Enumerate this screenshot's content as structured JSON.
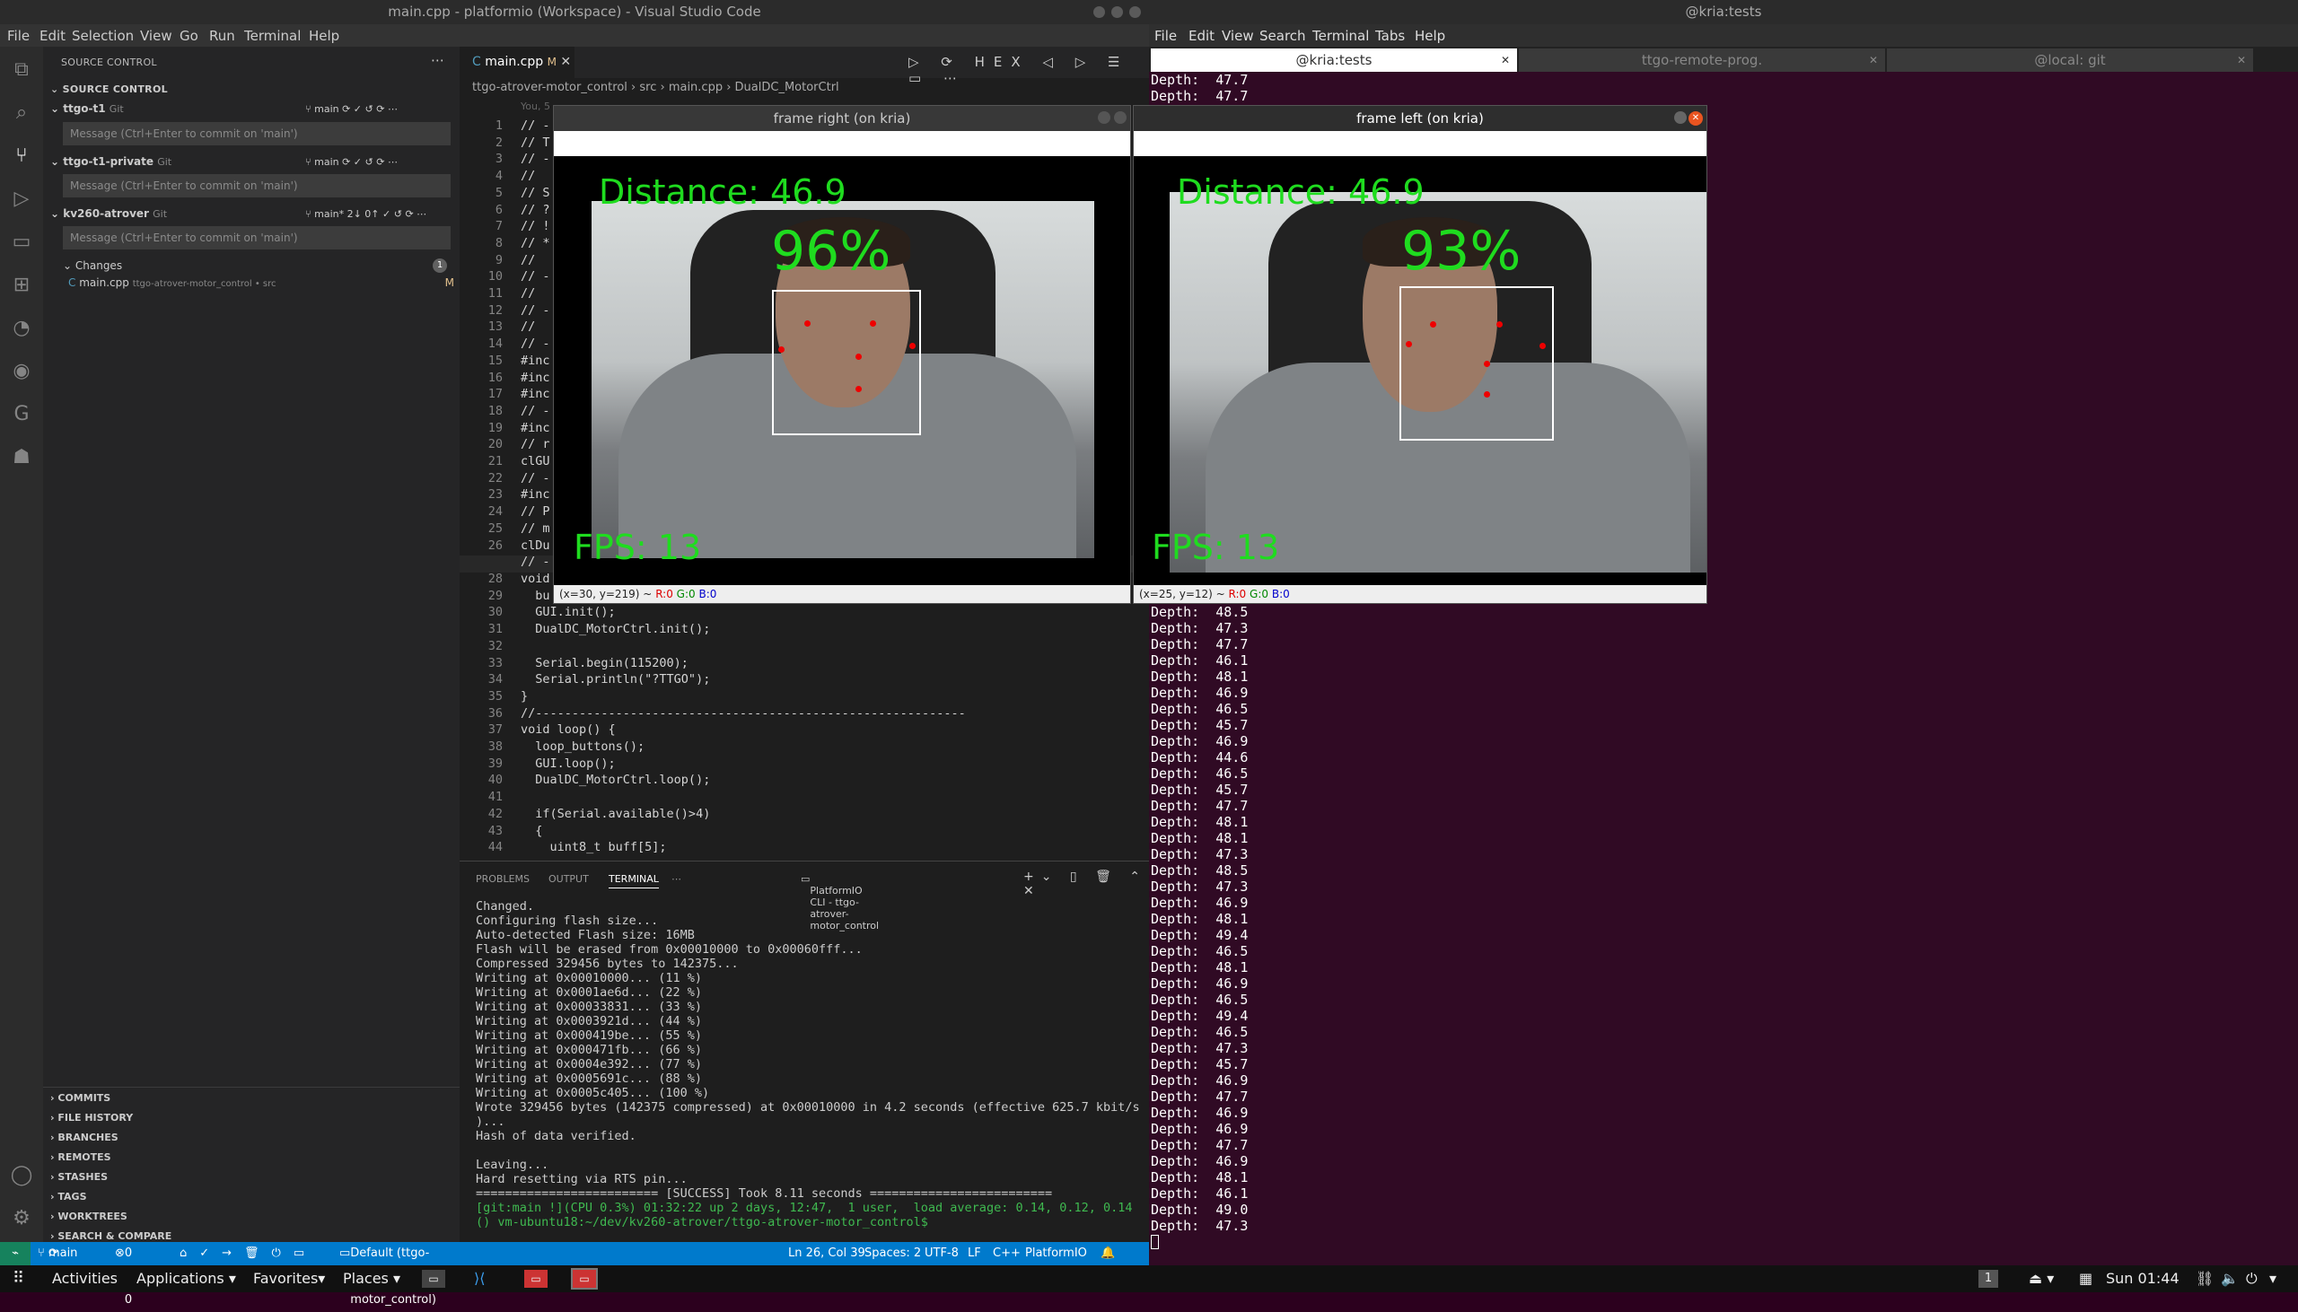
{
  "vscode": {
    "title": "main.cpp - platformio (Workspace) - Visual Studio Code",
    "menu": [
      "File",
      "Edit",
      "Selection",
      "View",
      "Go",
      "Run",
      "Terminal",
      "Help"
    ],
    "sidebar": {
      "header": "SOURCE CONTROL",
      "subheader": "SOURCE CONTROL",
      "repos": [
        {
          "name": "ttgo-t1",
          "type": "Git",
          "branch": "main",
          "placeholder": "Message (Ctrl+Enter to commit on 'main')"
        },
        {
          "name": "ttgo-t1-private",
          "type": "Git",
          "branch": "main",
          "placeholder": "Message (Ctrl+Enter to commit on 'main')"
        },
        {
          "name": "kv260-atrover",
          "type": "Git",
          "branch": "main*",
          "sync": "2↓ 0↑",
          "placeholder": "Message (Ctrl+Enter to commit on 'main')"
        }
      ],
      "changes_label": "Changes",
      "changes_count": "1",
      "change_file": "main.cpp",
      "change_path": "ttgo-atrover-motor_control • src",
      "change_status": "M",
      "sections": [
        "COMMITS",
        "FILE HISTORY",
        "BRANCHES",
        "REMOTES",
        "STASHES",
        "TAGS",
        "WORKTREES",
        "SEARCH & COMPARE"
      ]
    },
    "tab": {
      "label": "main.cpp",
      "status": "M"
    },
    "breadcrumb": [
      "ttgo-atrover-motor_control",
      "src",
      "main.cpp",
      "DualDC_MotorCtrl"
    ],
    "blame": "You, 5",
    "line_numbers": "1\n2\n3\n4\n5\n6\n7\n8\n9\n10\n11\n12\n13\n14\n15\n16\n17\n18\n19\n20\n21\n22\n23\n24\n25\n26\n27\n28\n29\n30\n31\n32\n33\n34\n35\n36\n37\n38\n39\n40\n41\n42\n43\n44",
    "code": "// -\n// T\n// -\n//\n// S\n// ?\n// !\n// *\n//\n// -\n//\n// -\n//\n// -\n#inc\n#inc\n#inc\n// -\n#inc\n// r\nclGU\n// -\n#inc\n// P\n// m\nclDu\n// -\nvoid\n  bu\n  GUI.init();\n  DualDC_MotorCtrl.init();\n\n  Serial.begin(115200);\n  Serial.println(\"?TTGO\");\n}\n//-----------------------------------------------------------\nvoid loop() {\n  loop_buttons();\n  GUI.loop();\n  DualDC_MotorCtrl.loop();\n\n  if(Serial.available()>4)\n  {\n    uint8_t buff[5];",
    "panel_tabs": [
      "PROBLEMS",
      "OUTPUT",
      "TERMINAL"
    ],
    "terminal_name": "PlatformIO CLI - ttgo-atrover-motor_control",
    "terminal": "Changed.\nConfiguring flash size...\nAuto-detected Flash size: 16MB\nFlash will be erased from 0x00010000 to 0x00060fff...\nCompressed 329456 bytes to 142375...\nWriting at 0x00010000... (11 %)\nWriting at 0x0001ae6d... (22 %)\nWriting at 0x00033831... (33 %)\nWriting at 0x0003921d... (44 %)\nWriting at 0x000419be... (55 %)\nWriting at 0x000471fb... (66 %)\nWriting at 0x0004e392... (77 %)\nWriting at 0x0005691c... (88 %)\nWriting at 0x0005c405... (100 %)\nWrote 329456 bytes (142375 compressed) at 0x00010000 in 4.2 seconds (effective 625.7 kbit/s\n)...\nHash of data verified.\n\nLeaving...\nHard resetting via RTS pin...\n========================= [SUCCESS] Took 8.11 seconds =========================\n",
    "prompt_line1": "[git:main !](CPU 0.3%) 01:32:22 up 2 days, 12:47,  1 user,  load average: 0.14, 0.12, 0.14",
    "prompt_line2": "() vm-ubuntu18:~/dev/kv260-atrover/ttgo-atrover-motor_control$ ",
    "status": {
      "branch": "main",
      "problems": "0 ⚠ 0",
      "env": "Default (ttgo-atrover-motor_control)",
      "position": "Ln 26, Col 39",
      "spaces": "Spaces: 2",
      "encoding": "UTF-8",
      "eol": "LF",
      "lang": "C++",
      "ext": "PlatformIO"
    }
  },
  "terminal2": {
    "title": "@kria:tests",
    "menu": [
      "File",
      "Edit",
      "View",
      "Search",
      "Terminal",
      "Tabs",
      "Help"
    ],
    "tabs": [
      "@kria:tests",
      "ttgo-remote-prog.",
      "@local: git"
    ],
    "depth_top": "Depth:  47.7\nDepth:  47.7",
    "depth": "Depth:  48.5\nDepth:  47.3\nDepth:  47.7\nDepth:  46.1\nDepth:  48.1\nDepth:  46.9\nDepth:  46.5\nDepth:  45.7\nDepth:  46.9\nDepth:  44.6\nDepth:  46.5\nDepth:  45.7\nDepth:  47.7\nDepth:  48.1\nDepth:  48.1\nDepth:  47.3\nDepth:  48.5\nDepth:  47.3\nDepth:  46.9\nDepth:  48.1\nDepth:  49.4\nDepth:  46.5\nDepth:  48.1\nDepth:  46.9\nDepth:  46.5\nDepth:  49.4\nDepth:  46.5\nDepth:  47.3\nDepth:  45.7\nDepth:  46.9\nDepth:  47.7\nDepth:  46.9\nDepth:  46.9\nDepth:  47.7\nDepth:  46.9\nDepth:  48.1\nDepth:  46.1\nDepth:  49.0\nDepth:  47.3"
  },
  "frames": {
    "right": {
      "title": "frame right (on kria)",
      "distance": "Distance: 46.9",
      "confidence": "96%",
      "fps": "FPS: 13",
      "status_pos": "(x=30, y=219) ~",
      "r": "R:0",
      "g": "G:0",
      "b": "B:0"
    },
    "left": {
      "title": "frame left (on kria)",
      "distance": "Distance: 46.9",
      "confidence": "93%",
      "fps": "FPS: 13",
      "status_pos": "(x=25, y=12) ~",
      "r": "R:0",
      "g": "G:0",
      "b": "B:0"
    }
  },
  "taskbar": {
    "activities": "Activities",
    "applications": "Applications ▾",
    "favorites": "Favorites▾",
    "places": "Places ▾",
    "workspace": "1",
    "clock": "Sun 01:44"
  }
}
